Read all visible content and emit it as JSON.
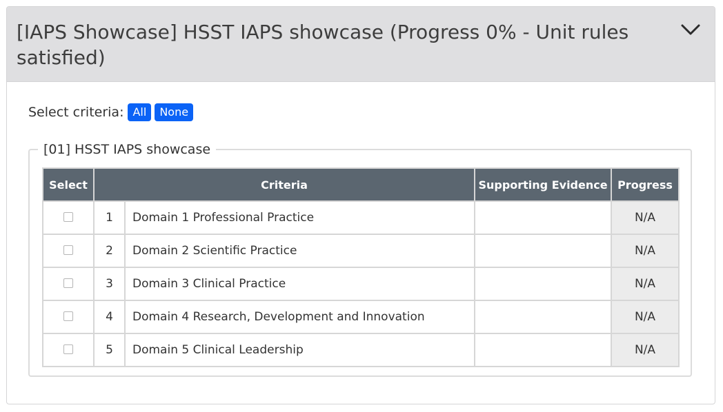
{
  "panel": {
    "title": "[IAPS Showcase] HSST IAPS showcase (Progress 0% - Unit rules satisfied)",
    "collapse_icon": "chevron-down-icon"
  },
  "select_criteria": {
    "label": "Select criteria:",
    "all_label": "All",
    "none_label": "None",
    "button_color": "#0b63f6"
  },
  "unit": {
    "legend": "[01] HSST IAPS showcase",
    "columns": {
      "select": "Select",
      "criteria": "Criteria",
      "evidence": "Supporting Evidence",
      "progress": "Progress"
    },
    "header_color": "#5b6670",
    "rows": [
      {
        "num": "1",
        "name": "Domain 1 Professional Practice",
        "evidence": "",
        "progress": "N/A",
        "checked": false
      },
      {
        "num": "2",
        "name": "Domain 2 Scientific Practice",
        "evidence": "",
        "progress": "N/A",
        "checked": false
      },
      {
        "num": "3",
        "name": "Domain 3 Clinical Practice",
        "evidence": "",
        "progress": "N/A",
        "checked": false
      },
      {
        "num": "4",
        "name": "Domain 4 Research, Development and Innovation",
        "evidence": "",
        "progress": "N/A",
        "checked": false
      },
      {
        "num": "5",
        "name": "Domain 5 Clinical Leadership",
        "evidence": "",
        "progress": "N/A",
        "checked": false
      }
    ]
  }
}
